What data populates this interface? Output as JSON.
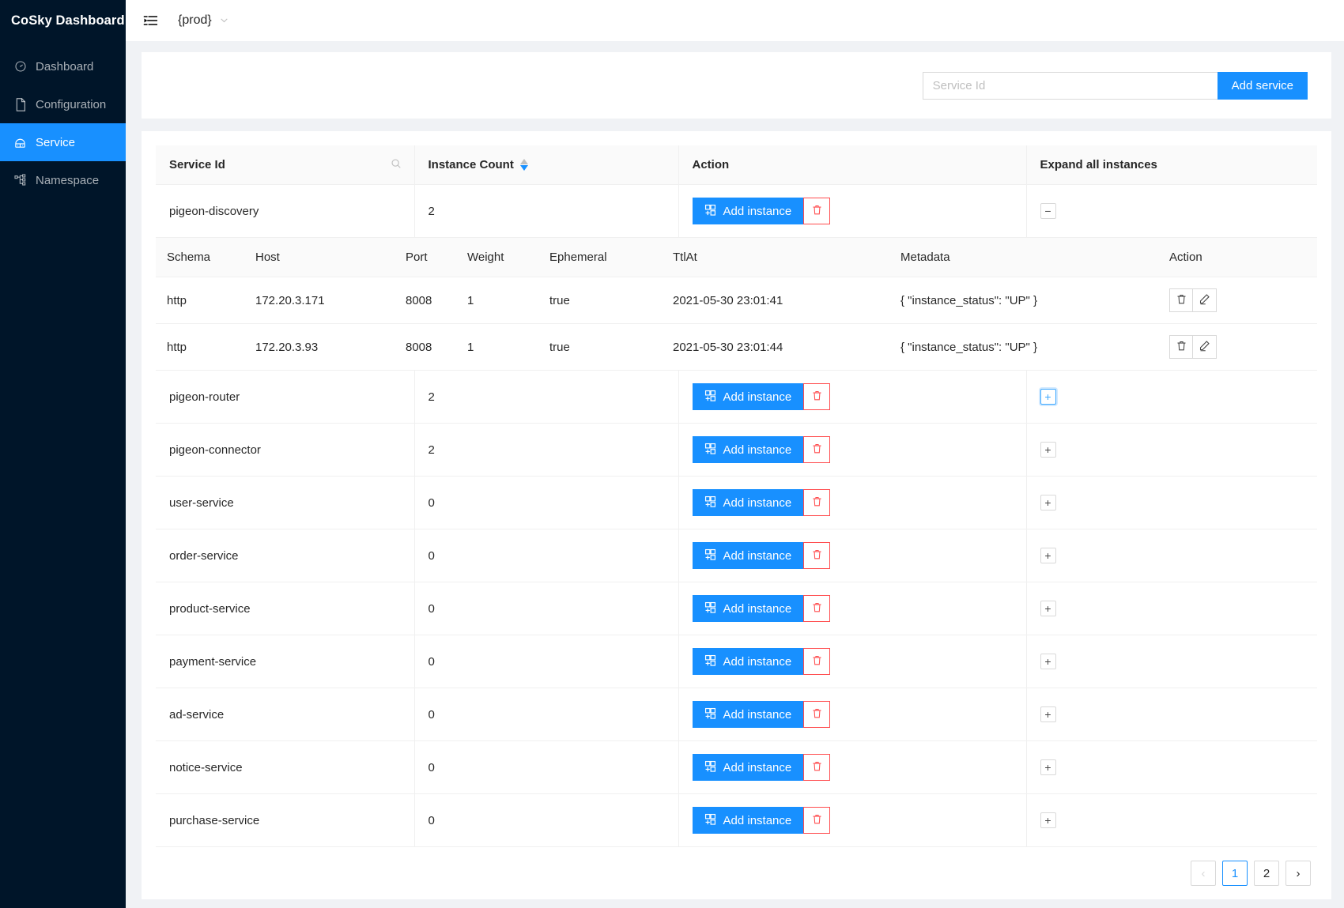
{
  "sidebar": {
    "brand": "CoSky Dashboard",
    "items": [
      {
        "label": "Dashboard",
        "icon": "dashboard-icon",
        "active": false
      },
      {
        "label": "Configuration",
        "icon": "file-icon",
        "active": false
      },
      {
        "label": "Service",
        "icon": "cloud-server-icon",
        "active": true
      },
      {
        "label": "Namespace",
        "icon": "nodes-icon",
        "active": false
      }
    ]
  },
  "topbar": {
    "collapse_icon": "menu-fold-icon",
    "namespace": "{prod}",
    "caret_icon": "chevron-down-icon"
  },
  "search": {
    "placeholder": "Service Id",
    "value": "",
    "add_service_label": "Add service"
  },
  "table": {
    "columns": [
      {
        "label": "Service Id",
        "has_search": true
      },
      {
        "label": "Instance Count",
        "has_sorter": true,
        "sort": "descend"
      },
      {
        "label": "Action"
      },
      {
        "label": "Expand all instances"
      }
    ],
    "add_instance_label": "Add instance",
    "rows": [
      {
        "service_id": "pigeon-discovery",
        "instance_count": "2",
        "expanded": true,
        "expand_glyph": "−",
        "focused": false
      },
      {
        "service_id": "pigeon-router",
        "instance_count": "2",
        "expanded": false,
        "expand_glyph": "+",
        "focused": true
      },
      {
        "service_id": "pigeon-connector",
        "instance_count": "2",
        "expanded": false,
        "expand_glyph": "+",
        "focused": false
      },
      {
        "service_id": "user-service",
        "instance_count": "0",
        "expanded": false,
        "expand_glyph": "+",
        "focused": false
      },
      {
        "service_id": "order-service",
        "instance_count": "0",
        "expanded": false,
        "expand_glyph": "+",
        "focused": false
      },
      {
        "service_id": "product-service",
        "instance_count": "0",
        "expanded": false,
        "expand_glyph": "+",
        "focused": false
      },
      {
        "service_id": "payment-service",
        "instance_count": "0",
        "expanded": false,
        "expand_glyph": "+",
        "focused": false
      },
      {
        "service_id": "ad-service",
        "instance_count": "0",
        "expanded": false,
        "expand_glyph": "+",
        "focused": false
      },
      {
        "service_id": "notice-service",
        "instance_count": "0",
        "expanded": false,
        "expand_glyph": "+",
        "focused": false
      },
      {
        "service_id": "purchase-service",
        "instance_count": "0",
        "expanded": false,
        "expand_glyph": "+",
        "focused": false
      }
    ]
  },
  "instance_table": {
    "columns": [
      "Schema",
      "Host",
      "Port",
      "Weight",
      "Ephemeral",
      "TtlAt",
      "Metadata",
      "Action"
    ],
    "rows": [
      {
        "schema": "http",
        "host": "172.20.3.171",
        "port": "8008",
        "weight": "1",
        "ephemeral": "true",
        "ttl_at": "2021-05-30 23:01:41",
        "metadata": "{ \"instance_status\": \"UP\" }"
      },
      {
        "schema": "http",
        "host": "172.20.3.93",
        "port": "8008",
        "weight": "1",
        "ephemeral": "true",
        "ttl_at": "2021-05-30 23:01:44",
        "metadata": "{ \"instance_status\": \"UP\" }"
      }
    ]
  },
  "pagination": {
    "prev": "‹",
    "next": "›",
    "pages": [
      "1",
      "2"
    ],
    "current": "1"
  },
  "colors": {
    "primary": "#1890ff",
    "danger": "#ff4d4f",
    "sidebar_bg": "#001529",
    "page_bg": "#f0f2f5"
  }
}
